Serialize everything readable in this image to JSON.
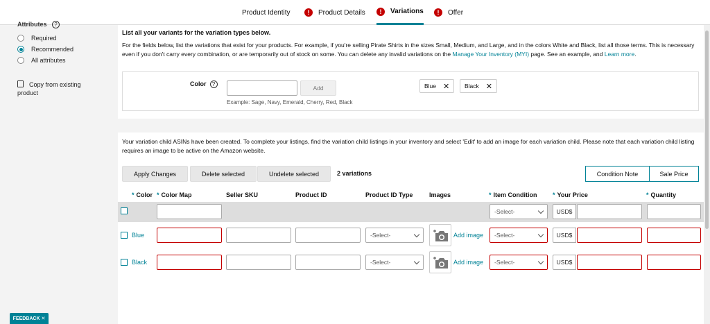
{
  "tabs": [
    {
      "label": "Product Identity",
      "error": false,
      "active": false
    },
    {
      "label": "Product Details",
      "error": true,
      "active": false
    },
    {
      "label": "Variations",
      "error": true,
      "active": true
    },
    {
      "label": "Offer",
      "error": true,
      "active": false
    }
  ],
  "sidebar": {
    "title": "Attributes",
    "options": [
      {
        "label": "Required",
        "selected": false
      },
      {
        "label": "Recommended",
        "selected": true
      },
      {
        "label": "All attributes",
        "selected": false
      }
    ],
    "copy_label": "Copy from existing product",
    "feedback_label": "FEEDBACK ✕"
  },
  "intro": {
    "heading": "List all your variants for the variation types below.",
    "text_1": "For the fields below, list the variations that exist for your products. For example, if you're selling Pirate Shirts in the sizes Small, Medium, and Large, and in the colors White and Black, list all those terms. This is necessary even if you don't carry every combination, or are temporarily out of stock on some. You can delete any invalid variations on the ",
    "link_1": "Manage Your Inventory (MYI)",
    "text_2": " page. See an example, and ",
    "link_2": "Learn more",
    "text_3": "."
  },
  "color_entry": {
    "label": "Color",
    "help": "?",
    "input_value": "",
    "add_label": "Add",
    "example": "Example: Sage, Navy, Emerald, Cherry, Red, Black",
    "chips": [
      "Blue",
      "Black"
    ]
  },
  "notice": "Your variation child ASINs have been created. To complete your listings, find the variation child listings in your inventory and select 'Edit' to add an image for each variation child. Please note that each variation child listing requires an image to be active on the Amazon website.",
  "actions": {
    "apply": "Apply Changes",
    "delete": "Delete selected",
    "undelete": "Undelete selected",
    "count": "2 variations",
    "condition_note": "Condition Note",
    "sale_price": "Sale Price"
  },
  "table": {
    "headers": [
      "Color",
      "Color Map",
      "Seller SKU",
      "Product ID",
      "Product ID Type",
      "Images",
      "Item Condition",
      "Your Price",
      "Quantity"
    ],
    "select_placeholder": "-Select-",
    "currency": "USD$",
    "add_image": "Add image",
    "rows": [
      {
        "color": "Blue"
      },
      {
        "color": "Black"
      }
    ]
  }
}
